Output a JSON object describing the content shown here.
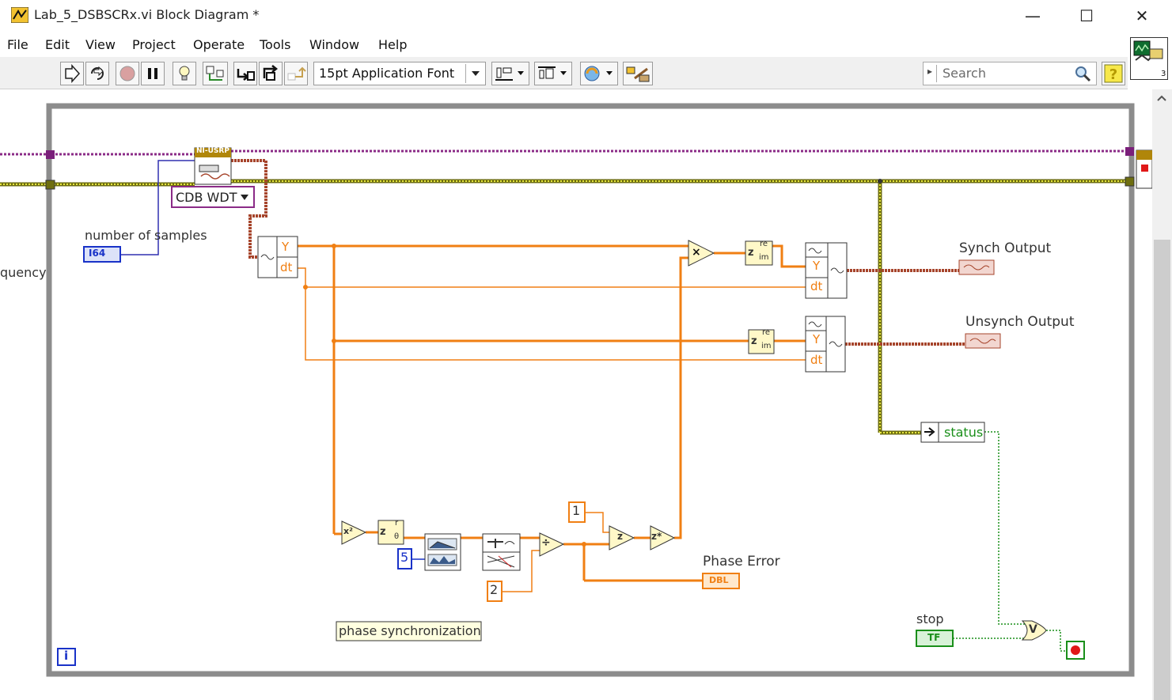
{
  "window": {
    "title": "Lab_5_DSBSCRx.vi Block Diagram *",
    "minimize_glyph": "—",
    "maximize_glyph": "☐",
    "close_glyph": "✕"
  },
  "menu": [
    "File",
    "Edit",
    "View",
    "Project",
    "Operate",
    "Tools",
    "Window",
    "Help"
  ],
  "toolbar": {
    "font": "15pt Application Font",
    "search_placeholder": "Search",
    "icons": [
      "run-arrow-icon",
      "run-continuously-icon",
      "abort-icon",
      "pause-icon",
      "highlight-execution-icon",
      "retain-wire-values-icon",
      "step-into-icon",
      "step-over-icon",
      "step-out-icon",
      "align-icon",
      "distribute-icon",
      "reorder-icon",
      "cleanup-diagram-icon",
      "search-icon",
      "help-icon"
    ]
  },
  "diagram": {
    "usrp_label": "NI-USRP",
    "usrp_format": "CDB WDT",
    "num_samples_label": "number of samples",
    "num_samples_type": "I64",
    "frequency_label_partial": "quency",
    "synch_label": "Synch Output",
    "unsynch_label": "Unsynch Output",
    "status_label": "status",
    "phase_error_label": "Phase Error",
    "phase_error_type": "DBL",
    "const_5": "5",
    "const_1": "1",
    "const_2": "2",
    "comment": "phase synchronization",
    "stop_label": "stop",
    "stop_type": "TF",
    "loop_iteration": "i",
    "y_label": "Y",
    "dt_label": "dt",
    "multiply": "×",
    "divide": "÷",
    "or": "V",
    "square": "x²",
    "re": "re",
    "im": "im",
    "z": "z",
    "r": "r",
    "theta": "θ",
    "conj": "z*"
  },
  "colors": {
    "orange_wire": "#f07f13",
    "waveform_wire": "#a6442b",
    "error_wire": "#6e6e10",
    "ref_wire": "#8b2b87",
    "loop_frame": "#8c8c8c",
    "bool_green": "#1a8f1a",
    "int_blue": "#1932c8"
  }
}
